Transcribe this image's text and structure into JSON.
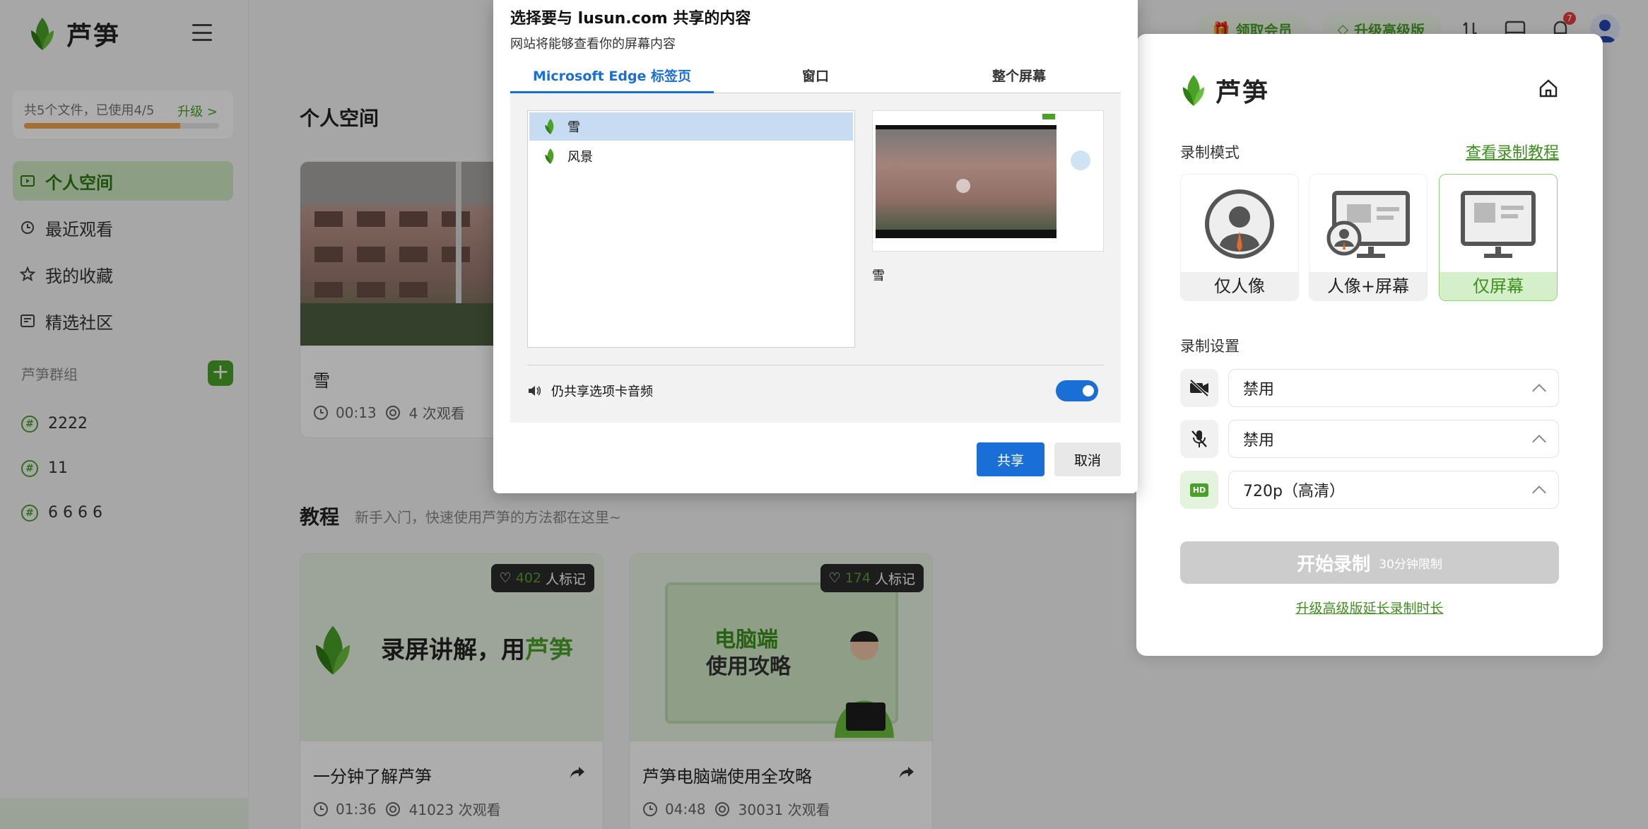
{
  "app": {
    "name": "芦笋"
  },
  "sidebar": {
    "storage_text": "共5个文件，已使用4/5",
    "storage_upgrade": "升级 >",
    "storage_fill_fraction": 0.8,
    "nav": [
      {
        "label": "个人空间",
        "icon": "folder-icon",
        "active": true
      },
      {
        "label": "最近观看",
        "icon": "history-icon",
        "active": false
      },
      {
        "label": "我的收藏",
        "icon": "star-icon",
        "active": false
      },
      {
        "label": "精选社区",
        "icon": "community-icon",
        "active": false
      }
    ],
    "group_title": "芦笋群组",
    "group_add": "+",
    "groups": [
      "2222",
      "11",
      "6 6 6 6"
    ]
  },
  "topbar": {
    "vip": "领取会员",
    "pro": "升级高级版",
    "notification_count": "7"
  },
  "main": {
    "personal_title": "个人空间",
    "video": {
      "title": "雪",
      "duration": "00:13",
      "views": "4 次观看"
    },
    "tutorial_title": "教程",
    "tutorial_sub": "新手入门，快速使用芦笋的方法都在这里~",
    "tutorials": [
      {
        "thumb_text_a": "录屏讲解，用",
        "thumb_text_b": "芦笋",
        "mark_count": "402",
        "mark_label": "人标记",
        "title": "一分钟了解芦笋",
        "duration": "01:36",
        "views": "41023 次观看"
      },
      {
        "thumb_text_a": "电脑端",
        "thumb_text_b": "使用攻略",
        "mark_count": "174",
        "mark_label": "人标记",
        "title": "芦笋电脑端使用全攻略",
        "duration": "04:48",
        "views": "30031 次观看"
      }
    ]
  },
  "recorder": {
    "mode_label": "录制模式",
    "tutorial_link": "查看录制教程",
    "modes": [
      {
        "label": "仅人像",
        "selected": false
      },
      {
        "label": "人像+屏幕",
        "selected": false
      },
      {
        "label": "仅屏幕",
        "selected": true
      }
    ],
    "settings_label": "录制设置",
    "camera": "禁用",
    "mic": "禁用",
    "quality": "720p（高清）",
    "hd_badge": "HD",
    "start": "开始录制",
    "start_limit": "30分钟限制",
    "upgrade_link": "升级高级版延长录制时长"
  },
  "dialog": {
    "title": "选择要与 lusun.com 共享的内容",
    "subtitle": "网站将能够查看你的屏幕内容",
    "tabs": [
      {
        "label": "Microsoft Edge 标签页",
        "active": true
      },
      {
        "label": "窗口",
        "active": false
      },
      {
        "label": "整个屏幕",
        "active": false
      }
    ],
    "items": [
      {
        "label": "雪",
        "selected": true
      },
      {
        "label": "风景",
        "selected": false
      }
    ],
    "preview_label": "雪",
    "audio_label": "仍共享选项卡音频",
    "audio_on": true,
    "share": "共享",
    "cancel": "取消"
  }
}
